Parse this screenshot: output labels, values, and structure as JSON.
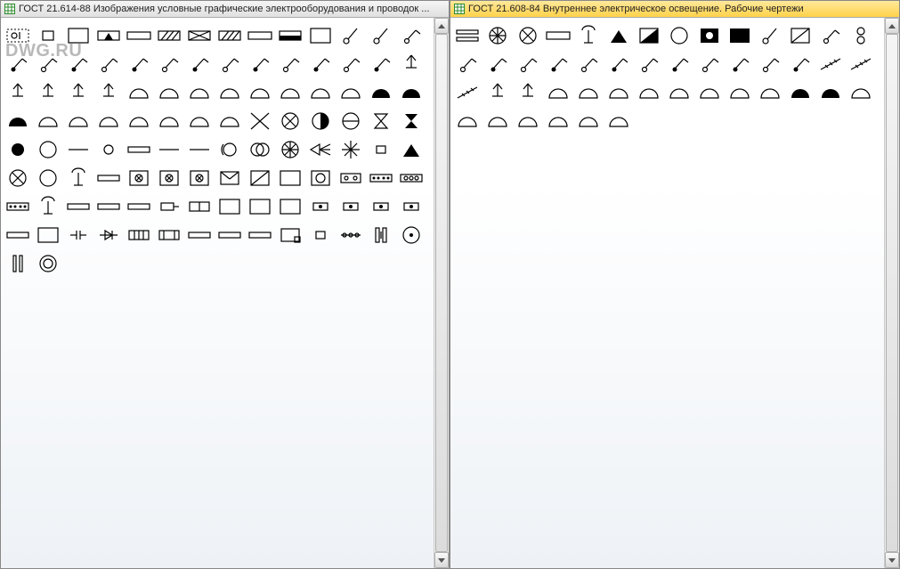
{
  "watermark": "DWG.RU",
  "panels": [
    {
      "id": "left",
      "title": "ГОСТ 21.614-88  Изображения условные графические  электрооборудования и проводок ...",
      "active": false,
      "symbols": [
        "socket-dashed",
        "socket-small-rect",
        "rect-outline",
        "rect-tri-top",
        "rect-long",
        "rect-diag1",
        "rect-diag2",
        "rect-diag3",
        "rect-thin",
        "rect-half-black",
        "rect-box",
        "circle-stick1",
        "line-stick1",
        "switch1",
        "switch2",
        "switch3",
        "switch4",
        "switch5",
        "switch6",
        "switch7",
        "switch8",
        "switch9",
        "switch10",
        "switch11",
        "switch12",
        "switch13",
        "switch14",
        "lamp-stem1",
        "lamp-stem2",
        "lamp-stem3",
        "lamp-stem4",
        "lamp-stem5",
        "lamp-dome1",
        "lamp-dome2",
        "lamp-dome3",
        "lamp-dome4",
        "lamp-dome5",
        "lamp-dome6",
        "lamp-dome7",
        "lamp-dome8",
        "lamp-black1",
        "lamp-black2",
        "lamp-black3",
        "lamp-dome9",
        "lamp-dome10",
        "lamp-dome11",
        "lamp-dome12",
        "lamp-dome13",
        "lamp-dome14",
        "lamp-dome15",
        "cross-x",
        "circle-cross",
        "circle-half",
        "circle-dash",
        "hourglass1",
        "hourglass2",
        "dot-big",
        "circle-big",
        "dash-dot",
        "circle-small",
        "rect-slim",
        "line-long",
        "line-short",
        "circle-bracket",
        "double-circle",
        "circle-pie",
        "spotlight",
        "spark",
        "rect-tiny",
        "tri-solid",
        "circle-x",
        "circle-plain",
        "tee",
        "rect-band",
        "rect-grid1",
        "rect-grid2",
        "rect-grid3",
        "rect-mail",
        "rect-diag",
        "rect-frame",
        "rect-target",
        "rect-dot2",
        "rect-5dot",
        "rect-3circ",
        "rect-5dot2",
        "tee2",
        "rect-bar1",
        "rect-bar2",
        "rect-bar3",
        "rect-handle",
        "rect-ht",
        "rect-box2",
        "rect-block1",
        "rect-block2",
        "dot-rect1",
        "dot-rect2",
        "dot-rect3",
        "dot-rect4",
        "rect-blank",
        "rect-frame2",
        "rect-cap",
        "rect-diode",
        "rect-lines",
        "rect-bars",
        "rect-empty",
        "rect-empty2",
        "rect-empty3",
        "rect-corner",
        "rect-small",
        "dot-chain",
        "bars-vert",
        "circle-dot",
        "double-bar",
        "circle-ring"
      ]
    },
    {
      "id": "right",
      "title": "ГОСТ 21.608-84  Внутреннее электрическое освещение. Рабочие чертежи",
      "active": true,
      "symbols": [
        "rect-slats",
        "circle-pie2",
        "circle-x2",
        "rect-long2",
        "tee3",
        "tri-solid2",
        "rect-diag-black",
        "circle-big2",
        "rect-black-dot",
        "rect-solid",
        "switch-r1",
        "rect-diag-box",
        "switch-r2",
        "double-loop",
        "switch-r3",
        "switch-r4",
        "switch-r5",
        "switch-r6",
        "switch-r7",
        "switch-r8",
        "switch-r9",
        "switch-r10",
        "switch-r11",
        "switch-r12",
        "switch-r13",
        "switch-r14",
        "line-ticks1",
        "line-ticks2",
        "line-ticks3",
        "lamp-stem-r1",
        "lamp-stem-r2",
        "lamp-dome-r1",
        "lamp-dome-r2",
        "lamp-dome-r3",
        "lamp-dome-r4",
        "lamp-dome-r5",
        "lamp-dome-r6",
        "lamp-dome-r7",
        "lamp-dome-r8",
        "lamp-black-r1",
        "lamp-black-r2",
        "lamp-dome-r9",
        "lamp-dome-r10",
        "lamp-dome-r11",
        "lamp-dome-r12",
        "lamp-dome-r13",
        "lamp-dome-r14",
        "lamp-dome-r15"
      ]
    }
  ],
  "glyphs": {
    "socket-dashed": {
      "type": "socketdash"
    },
    "socket-small-rect": {
      "type": "smallrect"
    },
    "rect-outline": {
      "type": "rect"
    },
    "rect-tri-top": {
      "type": "triup"
    },
    "rect-long": {
      "type": "longrect"
    },
    "rect-diag1": {
      "type": "hatch"
    },
    "rect-diag2": {
      "type": "cross"
    },
    "rect-diag3": {
      "type": "hatch"
    },
    "rect-thin": {
      "type": "longrect"
    },
    "rect-half-black": {
      "type": "halfblack"
    },
    "rect-box": {
      "type": "rect"
    },
    "circle-stick1": {
      "type": "stick"
    },
    "line-stick1": {
      "type": "stick"
    },
    "switch1": {
      "type": "switch"
    },
    "switch2": {
      "type": "switchf"
    },
    "switch3": {
      "type": "switch"
    },
    "switch4": {
      "type": "switchf"
    },
    "switch5": {
      "type": "switch"
    },
    "switch6": {
      "type": "switchf"
    },
    "switch7": {
      "type": "switch"
    },
    "switch8": {
      "type": "switchf"
    },
    "switch9": {
      "type": "switch"
    },
    "switch10": {
      "type": "switchf"
    },
    "switch11": {
      "type": "switch"
    },
    "switch12": {
      "type": "switchf"
    },
    "switch13": {
      "type": "switch"
    },
    "switch14": {
      "type": "switchf"
    },
    "lamp-stem1": {
      "type": "stem"
    },
    "lamp-stem2": {
      "type": "stem"
    },
    "lamp-stem3": {
      "type": "stem"
    },
    "lamp-stem4": {
      "type": "stem"
    },
    "lamp-stem5": {
      "type": "stem"
    },
    "lamp-dome1": {
      "type": "dome"
    },
    "lamp-dome2": {
      "type": "dome"
    },
    "lamp-dome3": {
      "type": "dome"
    },
    "lamp-dome4": {
      "type": "dome"
    },
    "lamp-dome5": {
      "type": "dome"
    },
    "lamp-dome6": {
      "type": "dome"
    },
    "lamp-dome7": {
      "type": "dome"
    },
    "lamp-dome8": {
      "type": "dome"
    },
    "lamp-black1": {
      "type": "domeb"
    },
    "lamp-black2": {
      "type": "domeb"
    },
    "lamp-black3": {
      "type": "domeb"
    },
    "lamp-dome9": {
      "type": "dome"
    },
    "lamp-dome10": {
      "type": "dome"
    },
    "lamp-dome11": {
      "type": "dome"
    },
    "lamp-dome12": {
      "type": "dome"
    },
    "lamp-dome13": {
      "type": "dome"
    },
    "lamp-dome14": {
      "type": "dome"
    },
    "lamp-dome15": {
      "type": "dome"
    },
    "cross-x": {
      "type": "bigx"
    },
    "circle-cross": {
      "type": "circx"
    },
    "circle-half": {
      "type": "circhalf"
    },
    "circle-dash": {
      "type": "circline"
    },
    "hourglass1": {
      "type": "hour"
    },
    "hourglass2": {
      "type": "hourf"
    },
    "dot-big": {
      "type": "dotf"
    },
    "circle-big": {
      "type": "circ"
    },
    "dash-dot": {
      "type": "line"
    },
    "circle-small": {
      "type": "circs"
    },
    "rect-slim": {
      "type": "slimrect"
    },
    "line-long": {
      "type": "line"
    },
    "line-short": {
      "type": "line"
    },
    "circle-bracket": {
      "type": "circbr"
    },
    "double-circle": {
      "type": "dblc"
    },
    "circle-pie": {
      "type": "pie"
    },
    "spotlight": {
      "type": "spot"
    },
    "spark": {
      "type": "spark"
    },
    "rect-tiny": {
      "type": "tinyrect"
    },
    "tri-solid": {
      "type": "trisolid"
    },
    "circle-x": {
      "type": "circx"
    },
    "circle-plain": {
      "type": "circ"
    },
    "tee": {
      "type": "tee"
    },
    "rect-band": {
      "type": "slimrect"
    },
    "rect-grid1": {
      "type": "grid"
    },
    "rect-grid2": {
      "type": "grid"
    },
    "rect-grid3": {
      "type": "grid"
    },
    "rect-mail": {
      "type": "mail"
    },
    "rect-diag": {
      "type": "rectdiag"
    },
    "rect-frame": {
      "type": "rect"
    },
    "rect-target": {
      "type": "target"
    },
    "rect-dot2": {
      "type": "rectdot"
    },
    "rect-5dot": {
      "type": "rect5"
    },
    "rect-3circ": {
      "type": "rect3c"
    },
    "rect-5dot2": {
      "type": "rect5"
    },
    "tee2": {
      "type": "tee"
    },
    "rect-bar1": {
      "type": "slimrect"
    },
    "rect-bar2": {
      "type": "slimrect"
    },
    "rect-bar3": {
      "type": "slimrect"
    },
    "rect-handle": {
      "type": "handle"
    },
    "rect-ht": {
      "type": "htee"
    },
    "rect-box2": {
      "type": "rect"
    },
    "rect-block1": {
      "type": "rect"
    },
    "rect-block2": {
      "type": "rect"
    },
    "dot-rect1": {
      "type": "smallrectdot"
    },
    "dot-rect2": {
      "type": "smallrectdot"
    },
    "dot-rect3": {
      "type": "smallrectdot"
    },
    "dot-rect4": {
      "type": "smallrectdot"
    },
    "rect-blank": {
      "type": "slimrect"
    },
    "rect-frame2": {
      "type": "rect"
    },
    "rect-cap": {
      "type": "cap"
    },
    "rect-diode": {
      "type": "diode"
    },
    "rect-lines": {
      "type": "lines"
    },
    "rect-bars": {
      "type": "bars"
    },
    "rect-empty": {
      "type": "slimrect"
    },
    "rect-empty2": {
      "type": "slimrect"
    },
    "rect-empty3": {
      "type": "slimrect"
    },
    "rect-corner": {
      "type": "corner"
    },
    "rect-small": {
      "type": "tinyrect"
    },
    "dot-chain": {
      "type": "chain"
    },
    "bars-vert": {
      "type": "vbars"
    },
    "circle-dot": {
      "type": "circdot"
    },
    "double-bar": {
      "type": "dbar"
    },
    "circle-ring": {
      "type": "ring"
    },
    "rect-slats": {
      "type": "slats"
    },
    "circle-pie2": {
      "type": "pie"
    },
    "circle-x2": {
      "type": "circx"
    },
    "rect-long2": {
      "type": "longrect"
    },
    "tee3": {
      "type": "tee"
    },
    "tri-solid2": {
      "type": "trisolid"
    },
    "rect-diag-black": {
      "type": "halfdiag"
    },
    "circle-big2": {
      "type": "circ"
    },
    "rect-black-dot": {
      "type": "blackdot"
    },
    "rect-solid": {
      "type": "rectf"
    },
    "switch-r1": {
      "type": "stick"
    },
    "rect-diag-box": {
      "type": "rectdiag"
    },
    "switch-r2": {
      "type": "switch"
    },
    "double-loop": {
      "type": "dbll"
    },
    "switch-r3": {
      "type": "switch"
    },
    "switch-r4": {
      "type": "switchf"
    },
    "switch-r5": {
      "type": "switch"
    },
    "switch-r6": {
      "type": "switchf"
    },
    "switch-r7": {
      "type": "switch"
    },
    "switch-r8": {
      "type": "switchf"
    },
    "switch-r9": {
      "type": "switch"
    },
    "switch-r10": {
      "type": "switchf"
    },
    "switch-r11": {
      "type": "switch"
    },
    "switch-r12": {
      "type": "switchf"
    },
    "switch-r13": {
      "type": "switch"
    },
    "switch-r14": {
      "type": "switchf"
    },
    "line-ticks1": {
      "type": "ticks"
    },
    "line-ticks2": {
      "type": "ticks"
    },
    "line-ticks3": {
      "type": "ticks"
    },
    "lamp-stem-r1": {
      "type": "stem"
    },
    "lamp-stem-r2": {
      "type": "stem"
    },
    "lamp-dome-r1": {
      "type": "dome"
    },
    "lamp-dome-r2": {
      "type": "dome"
    },
    "lamp-dome-r3": {
      "type": "dome"
    },
    "lamp-dome-r4": {
      "type": "dome"
    },
    "lamp-dome-r5": {
      "type": "dome"
    },
    "lamp-dome-r6": {
      "type": "dome"
    },
    "lamp-dome-r7": {
      "type": "dome"
    },
    "lamp-dome-r8": {
      "type": "dome"
    },
    "lamp-black-r1": {
      "type": "domeb"
    },
    "lamp-black-r2": {
      "type": "domeb"
    },
    "lamp-dome-r9": {
      "type": "dome"
    },
    "lamp-dome-r10": {
      "type": "dome"
    },
    "lamp-dome-r11": {
      "type": "dome"
    },
    "lamp-dome-r12": {
      "type": "dome"
    },
    "lamp-dome-r13": {
      "type": "dome"
    },
    "lamp-dome-r14": {
      "type": "dome"
    },
    "lamp-dome-r15": {
      "type": "dome"
    }
  }
}
